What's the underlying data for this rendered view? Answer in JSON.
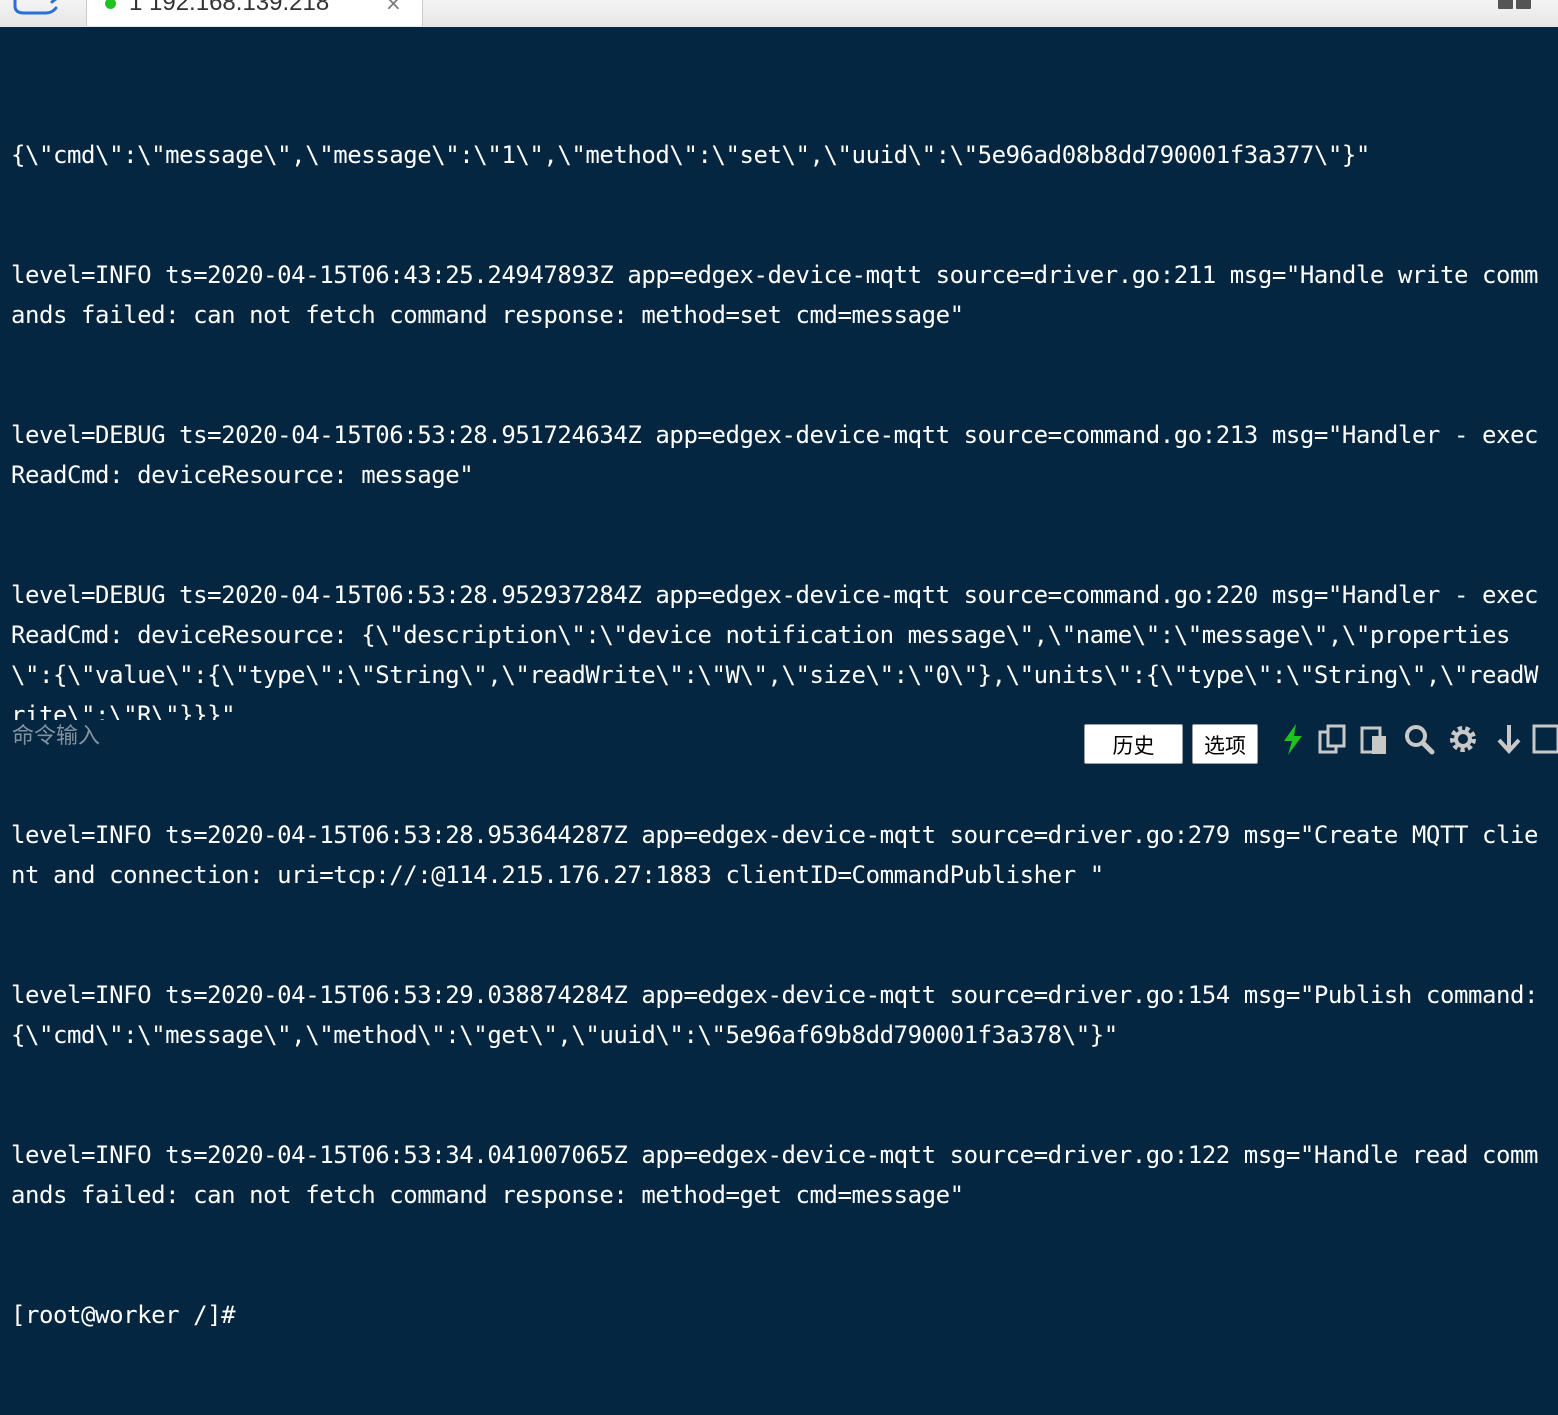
{
  "tab": {
    "title": "1 192.168.139.218",
    "close_label": "×",
    "status_color": "#1fc31f"
  },
  "terminal": {
    "lines": [
      "{\\\"cmd\\\":\\\"message\\\",\\\"message\\\":\\\"1\\\",\\\"method\\\":\\\"set\\\",\\\"uuid\\\":\\\"5e96ad08b8dd790001f3a377\\\"}\"",
      "level=INFO ts=2020-04-15T06:43:25.24947893Z app=edgex-device-mqtt source=driver.go:211 msg=\"Handle write commands failed: can not fetch command response: method=set cmd=message\"",
      "level=DEBUG ts=2020-04-15T06:53:28.951724634Z app=edgex-device-mqtt source=command.go:213 msg=\"Handler - execReadCmd: deviceResource: message\"",
      "level=DEBUG ts=2020-04-15T06:53:28.952937284Z app=edgex-device-mqtt source=command.go:220 msg=\"Handler - execReadCmd: deviceResource: {\\\"description\\\":\\\"device notification message\\\",\\\"name\\\":\\\"message\\\",\\\"properties\\\":{\\\"value\\\":{\\\"type\\\":\\\"String\\\",\\\"readWrite\\\":\\\"W\\\",\\\"size\\\":\\\"0\\\"},\\\"units\\\":{\\\"type\\\":\\\"String\\\",\\\"readWrite\\\":\\\"R\\\"}}}\"",
      "level=INFO ts=2020-04-15T06:53:28.953644287Z app=edgex-device-mqtt source=driver.go:279 msg=\"Create MQTT client and connection: uri=tcp://:@114.215.176.27:1883 clientID=CommandPublisher \"",
      "level=INFO ts=2020-04-15T06:53:29.038874284Z app=edgex-device-mqtt source=driver.go:154 msg=\"Publish command: {\\\"cmd\\\":\\\"message\\\",\\\"method\\\":\\\"get\\\",\\\"uuid\\\":\\\"5e96af69b8dd790001f3a378\\\"}\"",
      "level=INFO ts=2020-04-15T06:53:34.041007065Z app=edgex-device-mqtt source=driver.go:122 msg=\"Handle read commands failed: can not fetch command response: method=get cmd=message\"",
      "[root@worker /]#"
    ]
  },
  "command_bar": {
    "input_placeholder": "命令输入",
    "history_label": "历史",
    "options_label": "选项",
    "icons": [
      "lightning-icon",
      "copy-icon",
      "paste-icon",
      "search-icon",
      "gear-icon",
      "download-icon",
      "window-icon"
    ],
    "accent_color": "#1fc31f"
  },
  "colors": {
    "terminal_background": "#042640",
    "terminal_text": "#ffffff"
  }
}
